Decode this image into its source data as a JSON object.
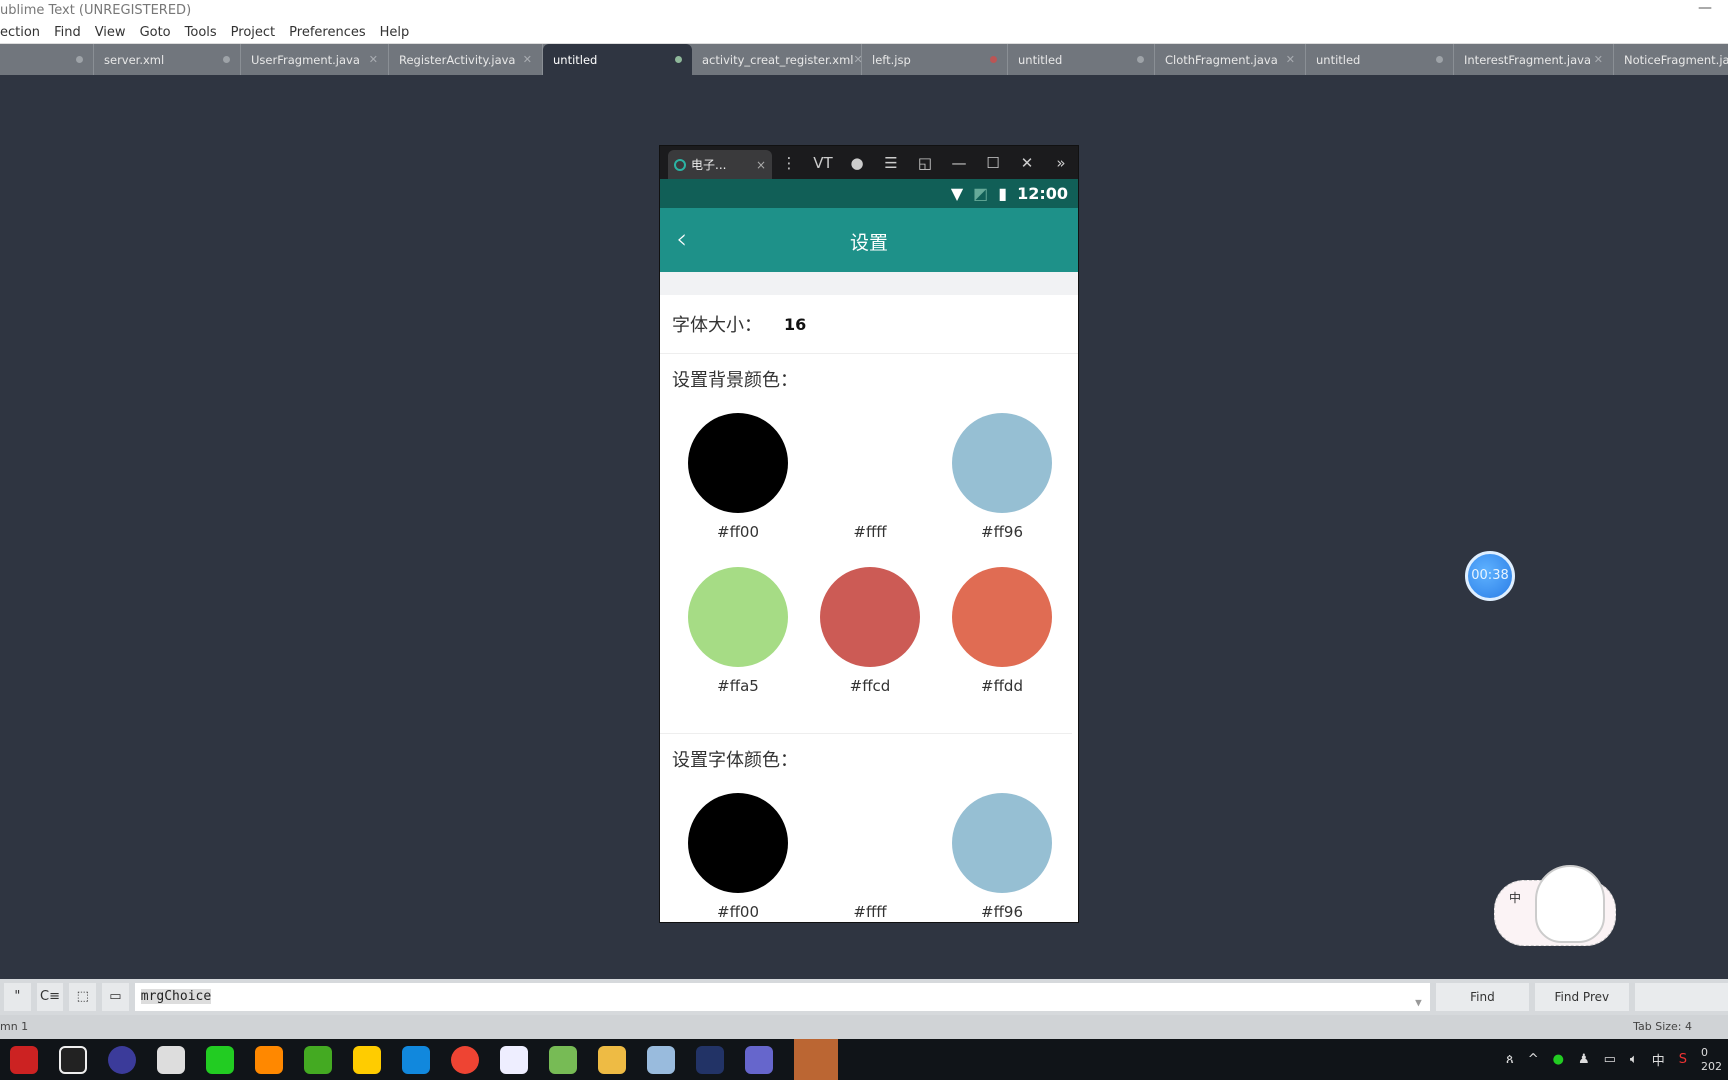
{
  "window": {
    "title": "ublime Text (UNREGISTERED)",
    "minimize": "—"
  },
  "menu": [
    "ection",
    "Find",
    "View",
    "Goto",
    "Tools",
    "Project",
    "Preferences",
    "Help"
  ],
  "tabs": [
    {
      "label": "",
      "state": "modified"
    },
    {
      "label": "server.xml",
      "state": "modified"
    },
    {
      "label": "UserFragment.java",
      "state": "close"
    },
    {
      "label": "RegisterActivity.java",
      "state": "close"
    },
    {
      "label": "untitled",
      "state": "active-modified"
    },
    {
      "label": "activity_creat_register.xml",
      "state": "close"
    },
    {
      "label": "left.jsp",
      "state": "modified-red"
    },
    {
      "label": "untitled",
      "state": "modified"
    },
    {
      "label": "ClothFragment.java",
      "state": "close"
    },
    {
      "label": "untitled",
      "state": "modified"
    },
    {
      "label": "InterestFragment.java",
      "state": "close"
    },
    {
      "label": "NoticeFragment.java",
      "state": "close"
    }
  ],
  "emulator": {
    "tab_label": "电子...",
    "tab_close": "×",
    "vt": "VT",
    "status_time": "12:00",
    "app_title": "设置",
    "back": "‹",
    "font_size_label": "字体大小：",
    "font_size_value": "16",
    "bg_section": "设置背景颜色：",
    "bg_colors": [
      {
        "label": "#ff00",
        "color": "#000000"
      },
      {
        "label": "#ffff",
        "color": "#ffffff"
      },
      {
        "label": "#ff96",
        "color": "#96bfd3"
      },
      {
        "label": "#ffa5",
        "color": "#a6dc85"
      },
      {
        "label": "#ffcd",
        "color": "#cc5b55"
      },
      {
        "label": "#ffdd",
        "color": "#e06c53"
      }
    ],
    "font_section": "设置字体颜色：",
    "font_colors": [
      {
        "label": "#ff00",
        "color": "#000000"
      },
      {
        "label": "#ffff",
        "color": "#ffffff"
      },
      {
        "label": "#ff96",
        "color": "#96bfd3"
      }
    ]
  },
  "timer": "00:38",
  "sticker_char": "中",
  "find": {
    "value": "mrgChoice",
    "find": "Find",
    "find_prev": "Find Prev"
  },
  "statusbar": {
    "left": "mn 1",
    "right": "Tab Size: 4"
  },
  "tray": {
    "ime": "中",
    "clock": "0",
    "date": "202"
  }
}
